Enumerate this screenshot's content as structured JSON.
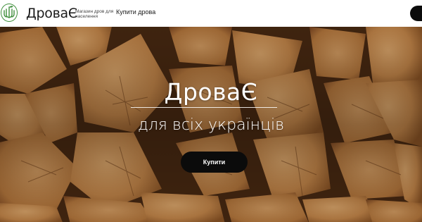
{
  "header": {
    "brand_name": "ДроваЄ",
    "tagline": "Магазин дров для населення",
    "nav_buy_label": "Купити дрова",
    "logo_icon": "trident-leaf-logo-icon"
  },
  "hero": {
    "title": "ДроваЄ",
    "subtitle": "для всіх українців",
    "buy_button_label": "Купити",
    "background": "firewood-logs-photo"
  },
  "colors": {
    "accent_dark": "#0b0b0b",
    "logo_green": "#3f8f3c",
    "wood_light": "#c98d4f",
    "wood_dark": "#5a3316"
  }
}
